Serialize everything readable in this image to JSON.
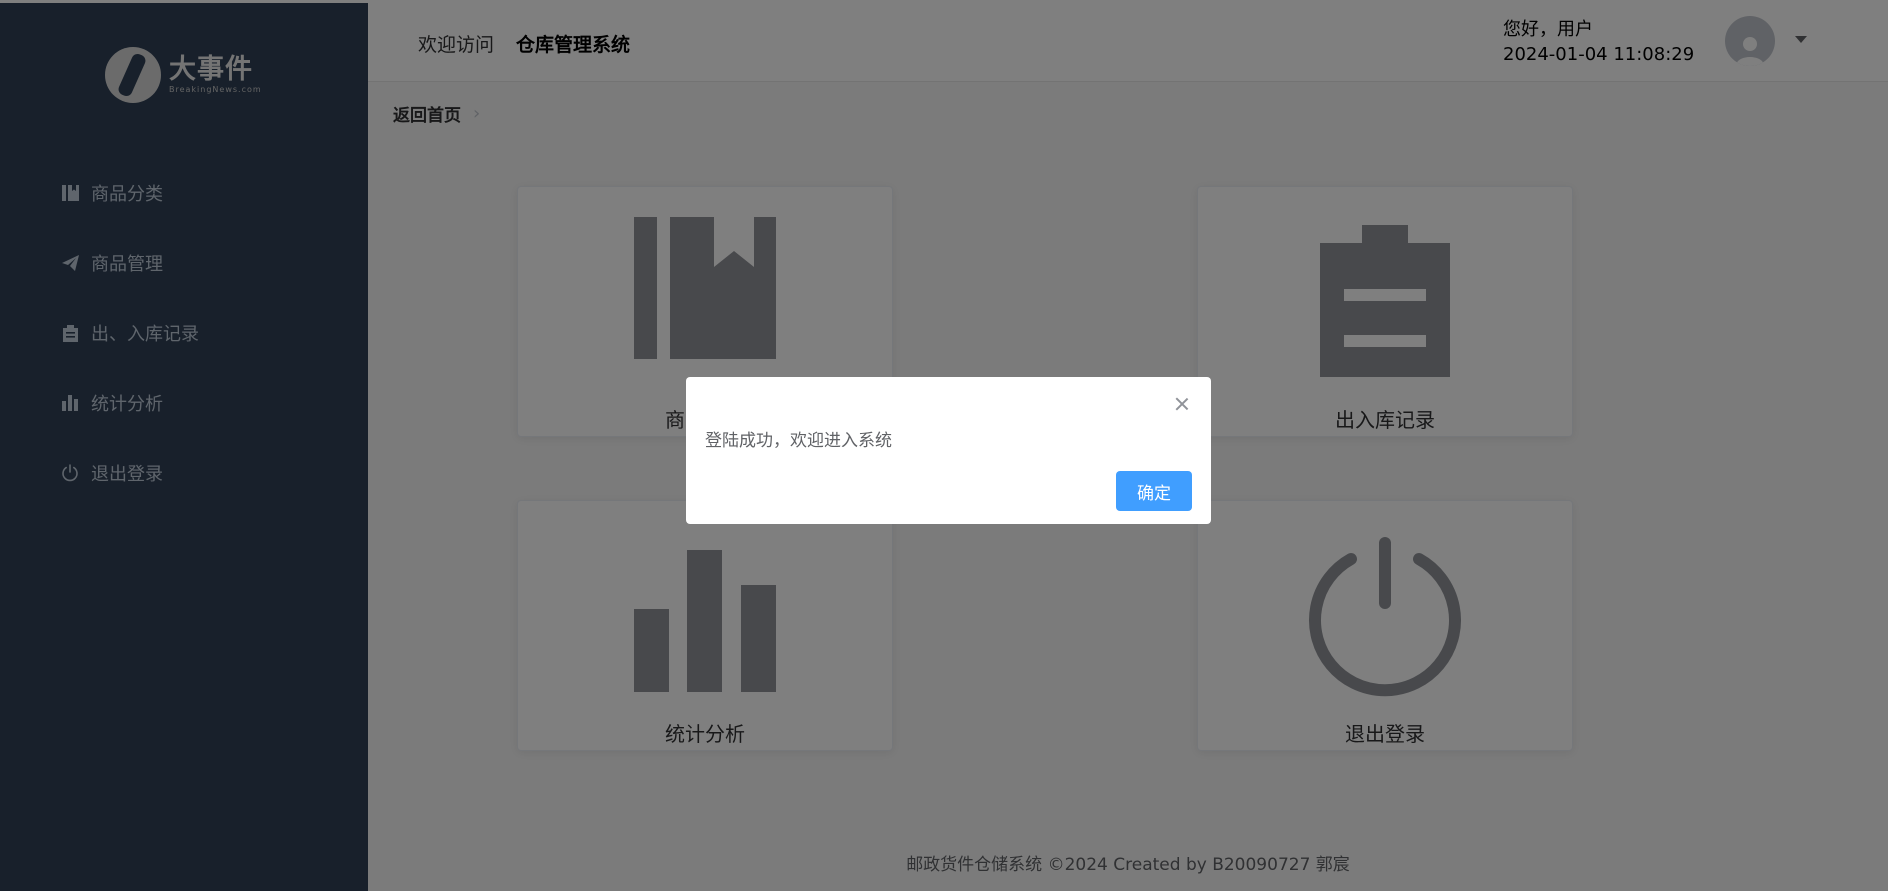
{
  "logo": {
    "title": "大事件",
    "subtitle": "BreakingNews.com"
  },
  "sidebar": {
    "items": [
      {
        "label": "商品分类",
        "icon": "book-icon"
      },
      {
        "label": "商品管理",
        "icon": "paper-plane-icon"
      },
      {
        "label": "出、入库记录",
        "icon": "clipboard-icon"
      },
      {
        "label": "统计分析",
        "icon": "bar-chart-icon"
      },
      {
        "label": "退出登录",
        "icon": "power-icon"
      }
    ]
  },
  "header": {
    "welcome": "欢迎访问",
    "system_name": "仓库管理系统",
    "greeting": "您好，用户",
    "datetime": "2024-01-04 11:08:29"
  },
  "breadcrumb": {
    "home": "返回首页"
  },
  "cards": [
    {
      "label": "商品分类",
      "icon": "book-icon"
    },
    {
      "label": "出入库记录",
      "icon": "clipboard-icon"
    },
    {
      "label": "统计分析",
      "icon": "bar-chart-icon"
    },
    {
      "label": "退出登录",
      "icon": "power-icon"
    }
  ],
  "footer": {
    "text": "邮政货件仓储系统 ©2024 Created by B20090727 郭宸"
  },
  "dialog": {
    "message": "登陆成功，欢迎进入系统",
    "confirm_label": "确定"
  },
  "colors": {
    "sidebar_bg": "#304156",
    "primary": "#409eff",
    "menu_text": "#bfcbd9"
  }
}
